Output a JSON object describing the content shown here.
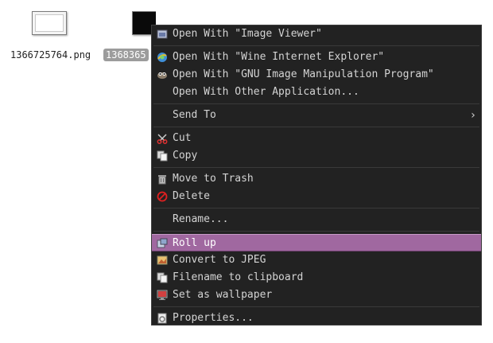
{
  "desktop": {
    "files": [
      {
        "name": "1366725764.png",
        "selected": false
      },
      {
        "name": "1368365",
        "selected": true
      }
    ]
  },
  "context_menu": {
    "items": [
      {
        "label": "Open With \"Image Viewer\"",
        "icon": "image-viewer-icon"
      },
      {
        "label": "Open With \"Wine Internet Explorer\"",
        "icon": "internet-explorer-icon"
      },
      {
        "label": "Open With \"GNU Image Manipulation Program\"",
        "icon": "gimp-icon"
      },
      {
        "label": "Open With Other Application...",
        "icon": ""
      },
      {
        "label": "Send To",
        "icon": "",
        "submenu": true
      },
      {
        "label": "Cut",
        "icon": "scissors-icon"
      },
      {
        "label": "Copy",
        "icon": "copy-icon"
      },
      {
        "label": "Move to Trash",
        "icon": "trash-icon"
      },
      {
        "label": "Delete",
        "icon": "delete-icon"
      },
      {
        "label": "Rename...",
        "icon": ""
      },
      {
        "label": "Roll up",
        "icon": "roll-up-icon",
        "highlighted": true
      },
      {
        "label": "Convert to JPEG",
        "icon": "convert-image-icon"
      },
      {
        "label": "Filename to clipboard",
        "icon": "clipboard-icon"
      },
      {
        "label": "Set as wallpaper",
        "icon": "wallpaper-icon"
      },
      {
        "label": "Properties...",
        "icon": "properties-icon"
      }
    ],
    "submenu_arrow": "›",
    "highlight_color": "#a068a0"
  }
}
